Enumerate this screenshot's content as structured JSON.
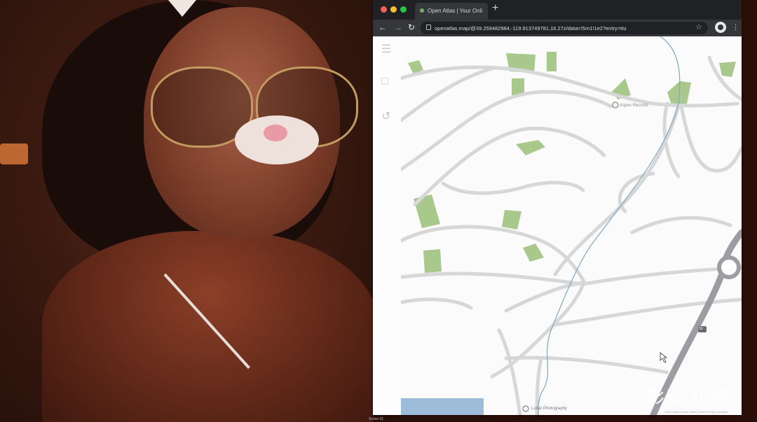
{
  "browser": {
    "tab_title": "Open Atlas | Your Onli",
    "new_tab_symbol": "+",
    "url": "openatlas.map/@39.259482984,-119.913749781,16.27z/data=!5m1!1e2?entry=ttu"
  },
  "map": {
    "pois": [
      {
        "name": "Aspen Records"
      },
      {
        "name": "Lunar Photography"
      }
    ],
    "route_badge": "50",
    "attribution": "Data ©Atlas   United States   Terms   Privacy   Feedback"
  },
  "caption": "Scene 01",
  "watermark": "影视邪神",
  "colors": {
    "park": "#a8c88c",
    "road": "#d7d7d7",
    "highway": "#9c9ca2",
    "water": "#9cbcd9",
    "stream": "#7fa7c0"
  }
}
